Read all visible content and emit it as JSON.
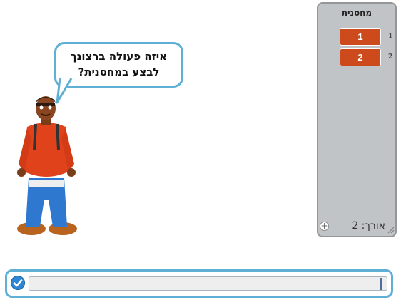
{
  "speech_bubble": {
    "line1": "איזה פעולה ברצונך",
    "line2": "לבצע במחסנית?"
  },
  "sprite": {
    "icon": "boy-character"
  },
  "list_monitor": {
    "title": "מחסנית",
    "items": [
      {
        "index": "1",
        "value": "1"
      },
      {
        "index": "2",
        "value": "2"
      }
    ],
    "length_label": "אורך: 2",
    "add_symbol": "+",
    "item_color": "#cc4a1b"
  },
  "ask_prompt": {
    "value": "",
    "border_color": "#5fb0d4",
    "submit_icon": "checkmark-icon"
  }
}
